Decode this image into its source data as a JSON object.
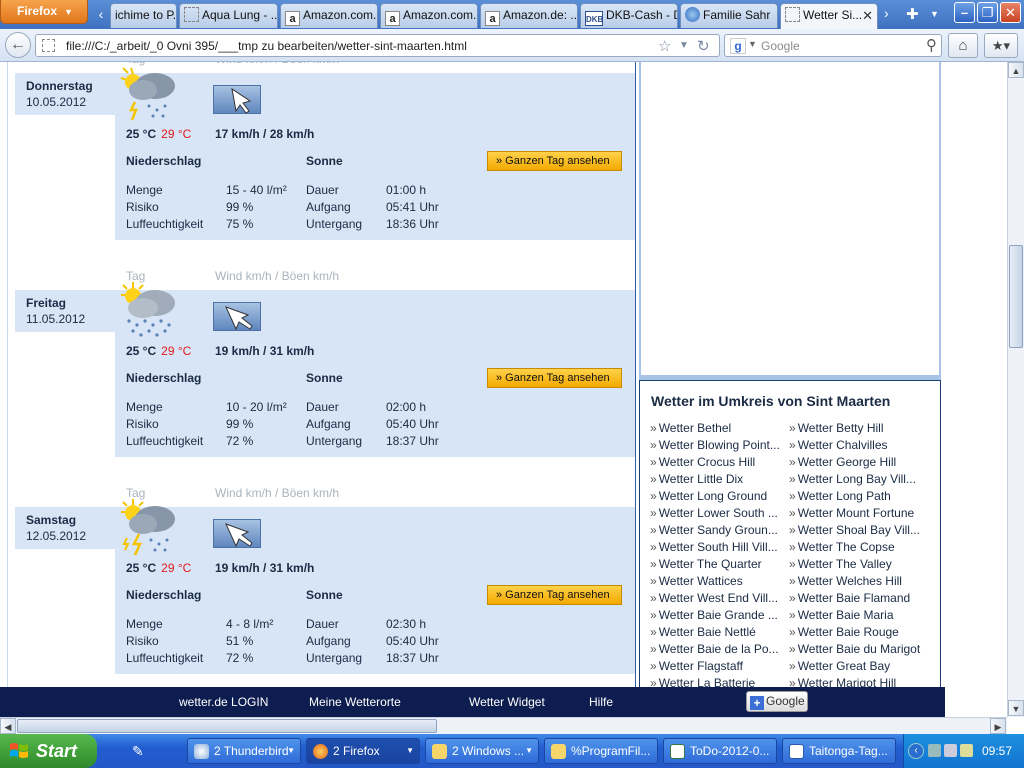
{
  "browser": {
    "app_button": "Firefox",
    "tabs": [
      {
        "label": "ichime to P...",
        "icon": "none"
      },
      {
        "label": "Aqua Lung - ...",
        "icon": "blank-page"
      },
      {
        "label": "Amazon.com...",
        "icon": "amazon"
      },
      {
        "label": "Amazon.com...",
        "icon": "amazon"
      },
      {
        "label": "Amazon.de: ...",
        "icon": "amazon"
      },
      {
        "label": "DKB-Cash - D...",
        "icon": "dkb"
      },
      {
        "label": "Familie Sahr",
        "icon": "globe"
      },
      {
        "label": "Wetter Si...",
        "icon": "blank-page",
        "active": true
      }
    ],
    "url": "file:///C:/_arbeit/_0 Ovni 395/___tmp zu bearbeiten/wetter-sint-maarten.html",
    "search_placeholder": "Google",
    "search_engine_icon": "g"
  },
  "weather": {
    "col_tag": "Tag",
    "col_wind": "Wind km/h / Böen km/h",
    "precip_title": "Niederschlag",
    "sun_title": "Sonne",
    "day_button": "» Ganzen Tag ansehen",
    "labels": {
      "amount": "Menge",
      "risk": "Risiko",
      "humidity": "Luffeuchtigkeit",
      "duration": "Dauer",
      "sunrise": "Aufgang",
      "sunset": "Untergang"
    },
    "days": [
      {
        "name": "Donnerstag",
        "date": "10.05.2012",
        "icon": "thunderstorm-cloud-icon",
        "temp_low": "25 °C",
        "temp_high": "29 °C",
        "wind": "17 km/h / 28 km/h",
        "amount": "15 - 40 l/m²",
        "risk": "99 %",
        "humidity": "75 %",
        "duration": "01:00 h",
        "sunrise": "05:41 Uhr",
        "sunset": "18:36 Uhr"
      },
      {
        "name": "Freitag",
        "date": "11.05.2012",
        "icon": "sun-rain-cloud-icon",
        "temp_low": "25 °C",
        "temp_high": "29 °C",
        "wind": "19 km/h / 31 km/h",
        "amount": "10 - 20 l/m²",
        "risk": "99 %",
        "humidity": "72 %",
        "duration": "02:00 h",
        "sunrise": "05:40 Uhr",
        "sunset": "18:37 Uhr"
      },
      {
        "name": "Samstag",
        "date": "12.05.2012",
        "icon": "sun-thunderstorm-cloud-icon",
        "temp_low": "25 °C",
        "temp_high": "29 °C",
        "wind": "19 km/h / 31 km/h",
        "amount": "4 - 8 l/m²",
        "risk": "51 %",
        "humidity": "72 %",
        "duration": "02:30 h",
        "sunrise": "05:40 Uhr",
        "sunset": "18:37 Uhr"
      }
    ]
  },
  "nearby": {
    "title": "Wetter im Umkreis von Sint Maarten",
    "bullet": "»",
    "left": [
      "Wetter Bethel",
      "Wetter Blowing Point...",
      "Wetter Crocus Hill",
      "Wetter Little Dix",
      "Wetter Long Ground",
      "Wetter Lower South ...",
      "Wetter Sandy Groun...",
      "Wetter South Hill Vill...",
      "Wetter The Quarter",
      "Wetter Wattices",
      "Wetter West End Vill...",
      "Wetter Baie Grande ...",
      "Wetter Baie Nettlé",
      "Wetter Baie de la Po...",
      "Wetter Flagstaff",
      "Wetter La Batterie"
    ],
    "right": [
      "Wetter Betty Hill",
      "Wetter Chalvilles",
      "Wetter George Hill",
      "Wetter Long Bay Vill...",
      "Wetter Long Path",
      "Wetter Mount Fortune",
      "Wetter Shoal Bay Vill...",
      "Wetter The Copse",
      "Wetter The Valley",
      "Wetter Welches Hill",
      "Wetter Baie Flamand",
      "Wetter Baie Maria",
      "Wetter Baie Rouge",
      "Wetter Baie du Marigot",
      "Wetter Great Bay",
      "Wetter Marigot Hill"
    ]
  },
  "footer": {
    "login": "wetter.de LOGIN",
    "my_places": "Meine Wetterorte",
    "widget": "Wetter Widget",
    "help": "Hilfe",
    "google_plus": "Google"
  },
  "taskbar": {
    "start": "Start",
    "tasks": [
      {
        "label": "2 Thunderbird",
        "icon": "thunderbird"
      },
      {
        "label": "2 Firefox",
        "icon": "firefox",
        "active": true
      },
      {
        "label": "2 Windows ...",
        "icon": "folder"
      },
      {
        "label": "%ProgramFil...",
        "icon": "folder"
      },
      {
        "label": "ToDo-2012-0...",
        "icon": "spreadsheet"
      },
      {
        "label": "Taitonga-Tag...",
        "icon": "document"
      }
    ],
    "clock": "09:57"
  }
}
